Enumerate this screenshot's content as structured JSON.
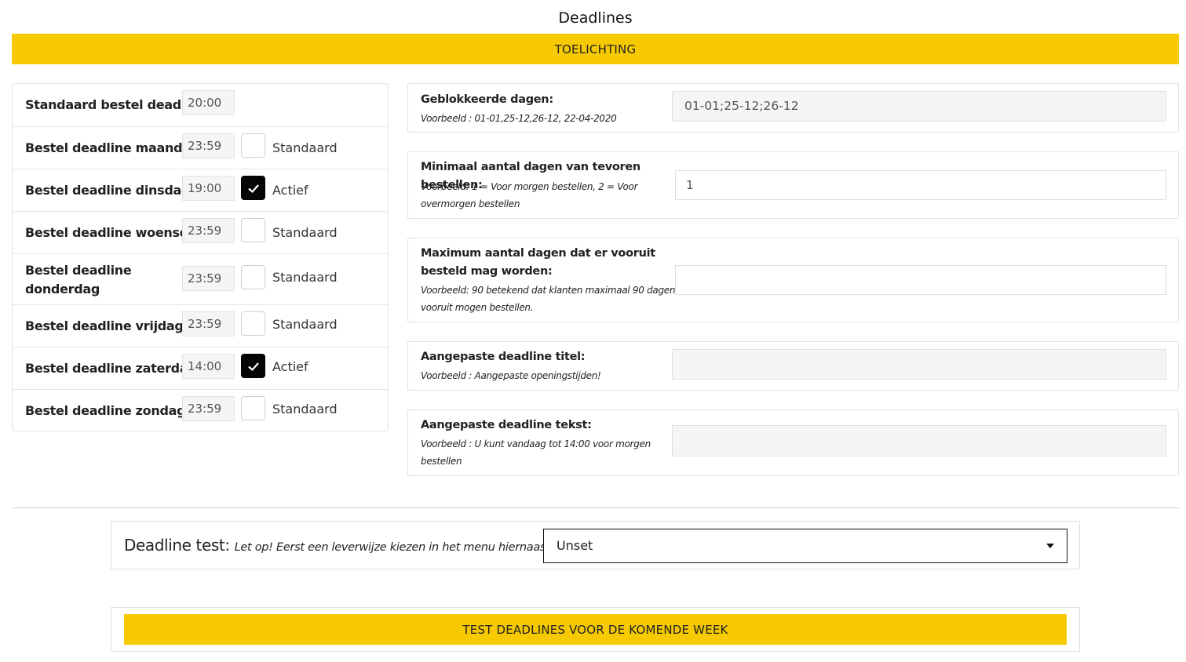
{
  "page": {
    "title": "Deadlines",
    "toelichting_label": "TOELICHTING"
  },
  "deadlines": {
    "rows": [
      {
        "label": "Standaard bestel deadline",
        "time": "20:00",
        "has_checkbox": false
      },
      {
        "label": "Bestel deadline maandag",
        "time": "23:59",
        "checked": false,
        "status": "Standaard"
      },
      {
        "label": "Bestel deadline dinsdag",
        "time": "19:00",
        "checked": true,
        "status": "Actief"
      },
      {
        "label": "Bestel deadline woensdag",
        "time": "23:59",
        "checked": false,
        "status": "Standaard"
      },
      {
        "label": "Bestel deadline donderdag",
        "time": "23:59",
        "checked": false,
        "status": "Standaard"
      },
      {
        "label": "Bestel deadline vrijdag",
        "time": "23:59",
        "checked": false,
        "status": "Standaard"
      },
      {
        "label": "Bestel deadline zaterdag",
        "time": "14:00",
        "checked": true,
        "status": "Actief"
      },
      {
        "label": "Bestel deadline zondag",
        "time": "23:59",
        "checked": false,
        "status": "Standaard"
      }
    ]
  },
  "settings": {
    "blocked_days": {
      "label": "Geblokkeerde dagen:",
      "example": "Voorbeeld : 01-01,25-12,26-12, 22-04-2020",
      "value": "01-01;25-12;26-12"
    },
    "min_days": {
      "label": "Minimaal aantal dagen van tevoren bestellen:",
      "example": "Voorbeeld: 1 = Voor morgen bestellen, 2 = Voor overmorgen bestellen",
      "value": "1"
    },
    "max_days": {
      "label": "Maximum aantal dagen dat er vooruit besteld mag worden:",
      "example": "Voorbeeld: 90 betekend dat klanten maximaal 90 dagen vooruit mogen bestellen.",
      "value": ""
    },
    "custom_title": {
      "label": "Aangepaste deadline titel:",
      "example": "Voorbeeld : Aangepaste openingstijden!",
      "value": ""
    },
    "custom_text": {
      "label": "Aangepaste deadline tekst:",
      "example": "Voorbeeld : U kunt vandaag tot 14:00 voor morgen bestellen",
      "value": ""
    }
  },
  "test": {
    "title": "Deadline test:",
    "note": "Let op! Eerst een leverwijze kiezen in het menu hiernaast.",
    "selected_option": "Unset",
    "button_label": "TEST DEADLINES VOOR DE KOMENDE WEEK"
  },
  "colors": {
    "accent": "#f6c900",
    "checkbox_checked": "#050505"
  },
  "icons": {
    "checkbox_check": "check-icon",
    "select_caret": "caret-down-icon"
  }
}
